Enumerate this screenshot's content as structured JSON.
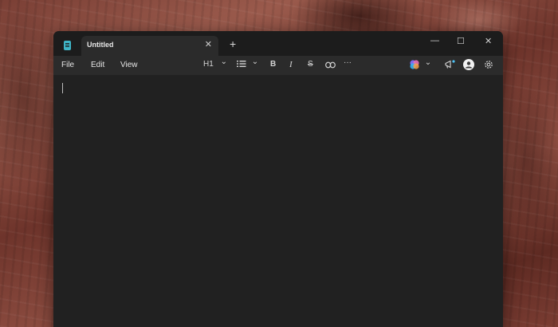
{
  "window": {
    "tab_title": "Untitled",
    "tab_close": "✕",
    "new_tab": "+",
    "controls": {
      "minimize": "—",
      "maximize": "☐",
      "close": "✕"
    }
  },
  "menu": {
    "items": [
      "File",
      "Edit",
      "View"
    ]
  },
  "toolbar": {
    "heading": "H1",
    "heading_chevron": "⌄",
    "list_chevron": "⌄",
    "bold": "B",
    "italic": "I",
    "strike": "S",
    "more": "···",
    "copilot_chevron": "⌄",
    "icons": [
      "app-icon",
      "list-icon",
      "link-icon",
      "copilot-icon",
      "megaphone-icon",
      "account-icon",
      "settings-icon"
    ]
  },
  "colors": {
    "window_bg": "#202020",
    "titlebar_bg": "#1c1c1c",
    "toolbar_bg": "#2b2b2b",
    "app_accent": "#3fb6c8",
    "notification_dot": "#4fc3f7"
  }
}
